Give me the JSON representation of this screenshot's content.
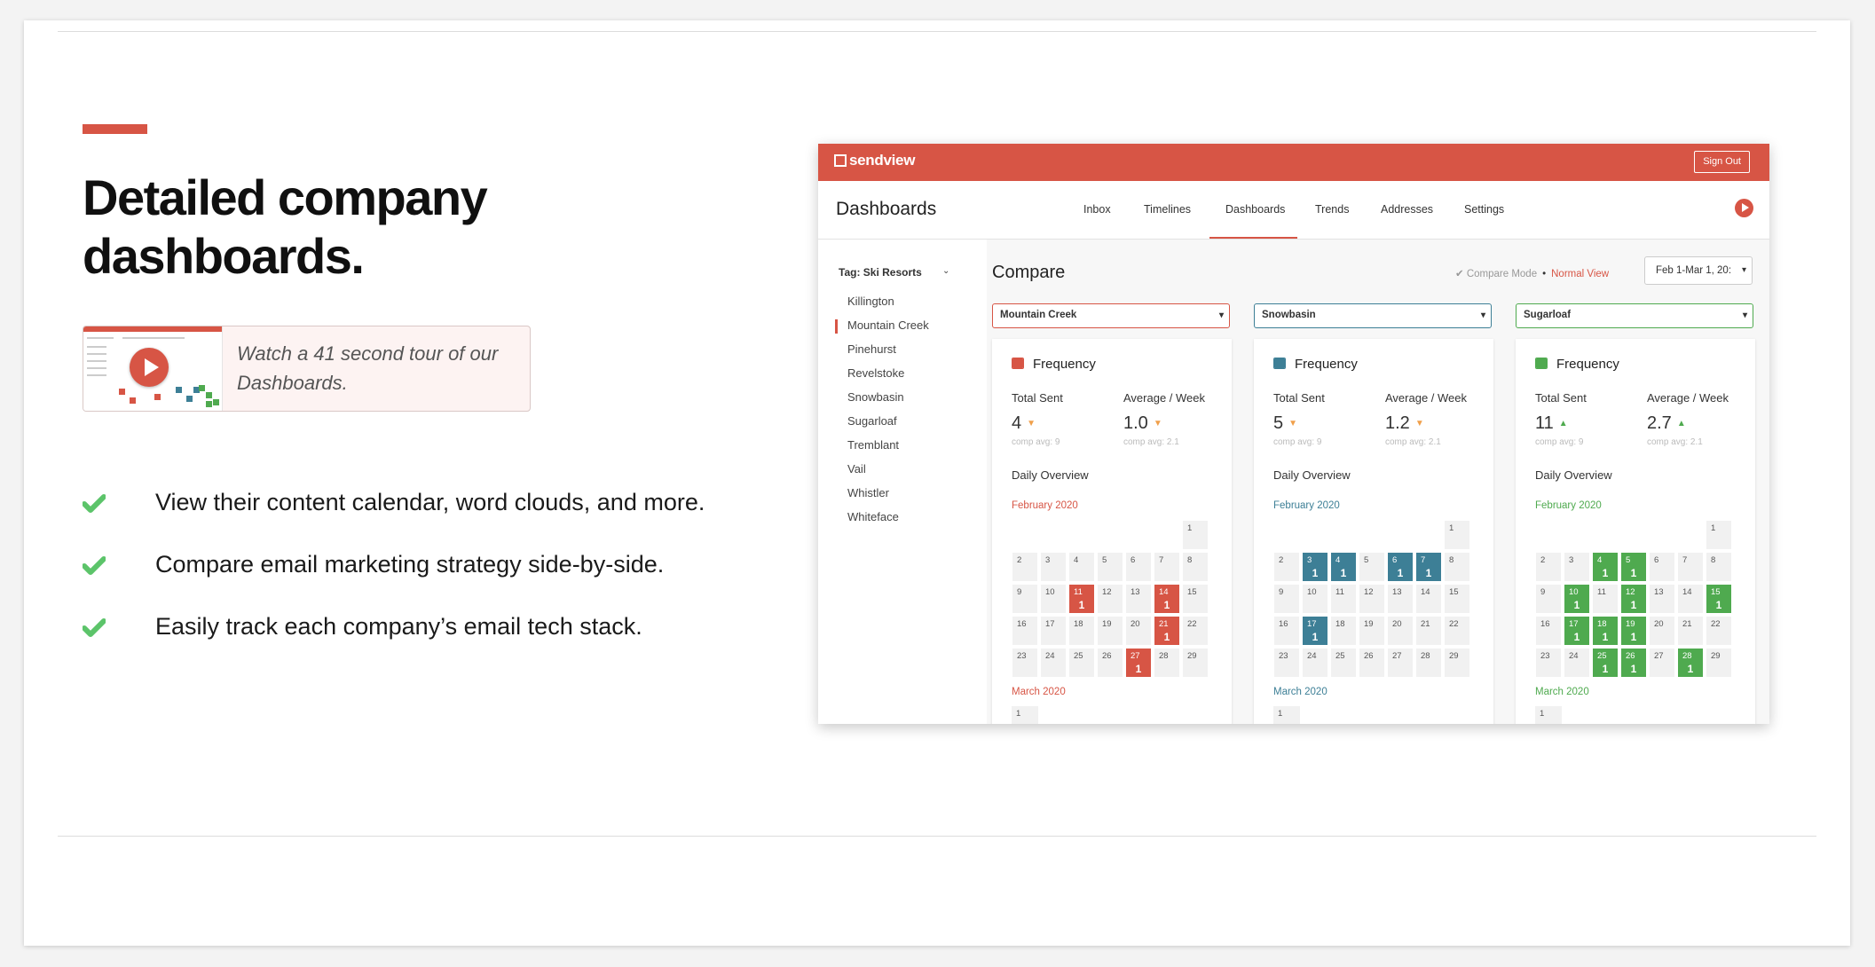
{
  "headline": "Detailed company dashboards.",
  "video": {
    "text": "Watch a 41 second tour of our Dashboards."
  },
  "features": [
    "View their content calendar, word clouds, and more.",
    "Compare email marketing strategy side-by-side.",
    "Easily track each company’s email tech stack."
  ],
  "colors": {
    "accent": "#d75545",
    "check": "#5cc46a",
    "red": "#d75545",
    "blue": "#3d7f96",
    "green": "#4faa4f"
  },
  "app": {
    "brand": "sendview",
    "sign_out": "Sign Out",
    "page_title": "Dashboards",
    "nav": [
      "Inbox",
      "Timelines",
      "Dashboards",
      "Trends",
      "Addresses",
      "Settings"
    ],
    "active_nav": "Dashboards",
    "tag": "Tag: Ski Resorts",
    "companies": [
      "Killington",
      "Mountain Creek",
      "Pinehurst",
      "Revelstoke",
      "Snowbasin",
      "Sugarloaf",
      "Tremblant",
      "Vail",
      "Whistler",
      "Whiteface"
    ],
    "active_company": "Mountain Creek",
    "compare_title": "Compare",
    "compare_mode": "✔ Compare Mode",
    "normal_view": "Normal View",
    "date_range": "Feb 1-Mar 1, 20:",
    "panels": [
      {
        "company": "Mountain Creek",
        "color": "#d75545",
        "title": "Frequency",
        "total_label": "Total Sent",
        "avg_label": "Average / Week",
        "total": "4",
        "total_trend": "down",
        "avg": "1.0",
        "avg_trend": "down",
        "total_comp": "comp avg: 9",
        "avg_comp": "comp avg: 2.1",
        "daily": "Daily Overview",
        "month1": "February 2020",
        "month2": "March 2020",
        "sent_days": [
          11,
          14,
          21,
          27
        ]
      },
      {
        "company": "Snowbasin",
        "color": "#3d7f96",
        "title": "Frequency",
        "total_label": "Total Sent",
        "avg_label": "Average / Week",
        "total": "5",
        "total_trend": "down",
        "avg": "1.2",
        "avg_trend": "down",
        "total_comp": "comp avg: 9",
        "avg_comp": "comp avg: 2.1",
        "daily": "Daily Overview",
        "month1": "February 2020",
        "month2": "March 2020",
        "sent_days": [
          3,
          4,
          6,
          7,
          17
        ]
      },
      {
        "company": "Sugarloaf",
        "color": "#4faa4f",
        "title": "Frequency",
        "total_label": "Total Sent",
        "avg_label": "Average / Week",
        "total": "11",
        "total_trend": "up",
        "avg": "2.7",
        "avg_trend": "up",
        "total_comp": "comp avg: 9",
        "avg_comp": "comp avg: 2.1",
        "daily": "Daily Overview",
        "month1": "February 2020",
        "month2": "March 2020",
        "sent_days": [
          4,
          5,
          10,
          12,
          15,
          17,
          18,
          19,
          25,
          26,
          28
        ]
      }
    ],
    "march_first": "1"
  }
}
